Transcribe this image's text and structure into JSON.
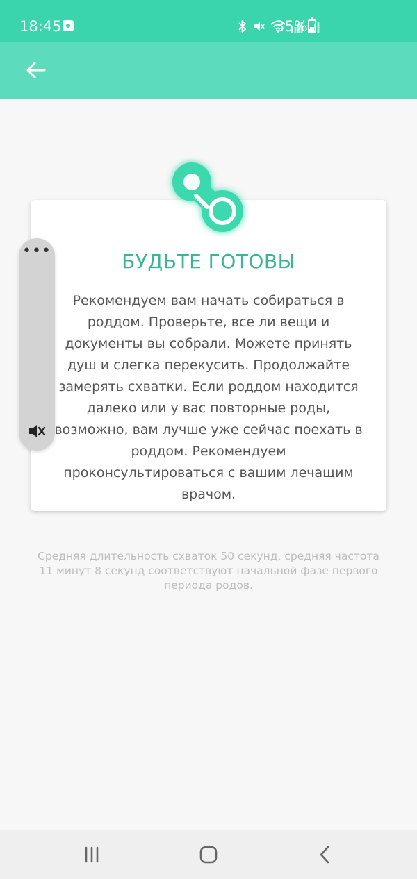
{
  "status_bar": {
    "time": "18:45",
    "battery": "35%",
    "icons": [
      "app-notification-icon",
      "bluetooth-icon",
      "vibrate-mute-icon",
      "wifi-icon",
      "signal-icon",
      "signal-icon",
      "battery-icon"
    ]
  },
  "app_bar": {
    "back_icon": "arrow-left-icon"
  },
  "card": {
    "icon": "pacifier-icon",
    "title": "БУДЬТЕ ГОТОВЫ",
    "body": "Рекомендуем вам начать собираться в роддом. Проверьте, все ли вещи и документы вы собрали. Можете принять душ и слегка перекусить. Продолжайте замерять схватки. Если роддом находится далеко или у вас повторные роды, возможно, вам лучше уже сейчас поехать в роддом. Рекомендуем проконсультироваться с вашим лечащим врачом."
  },
  "footnote": "Средняя длительность схваток 50 секунд, средняя частота 11 минут 8 секунд соответствуют начальной фазе первого периода родов.",
  "volume_panel": {
    "menu_label": "•••",
    "mute_icon": "volume-mute-icon"
  },
  "nav_bar": {
    "items": [
      "recents-icon",
      "home-icon",
      "back-icon"
    ]
  },
  "colors": {
    "status_bar": "#3ad4ad",
    "app_bar": "#5cdcbc",
    "accent": "#3cb596",
    "background": "#f7f7f7"
  }
}
